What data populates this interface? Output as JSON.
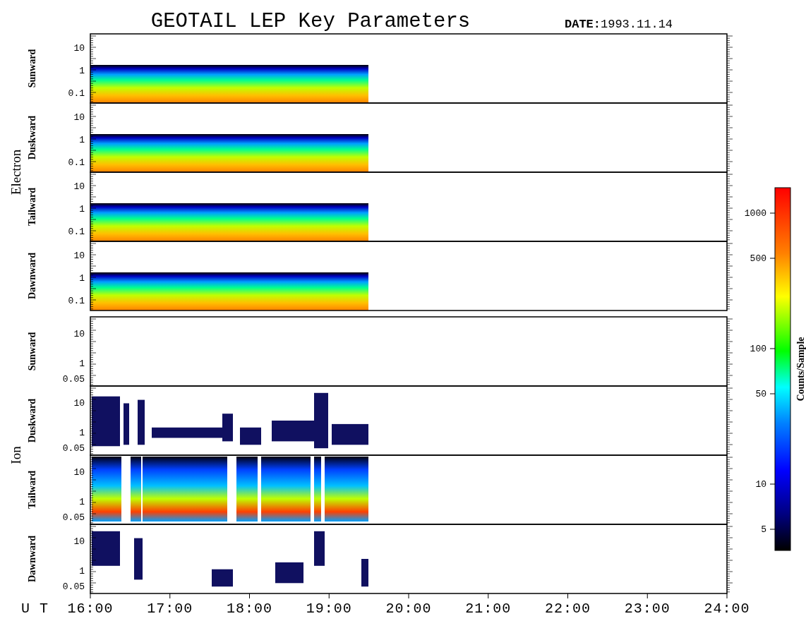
{
  "title": "GEOTAIL LEP Key Parameters",
  "date": {
    "label": "DATE:",
    "value": "1993.11.14"
  },
  "groups": [
    {
      "name": "Electron",
      "panels": [
        {
          "direction": "Sunward",
          "yticks": [
            "10",
            "1",
            "0.1"
          ]
        },
        {
          "direction": "Duskward",
          "yticks": [
            "10",
            "1",
            "0.1"
          ]
        },
        {
          "direction": "Tailward",
          "yticks": [
            "10",
            "1",
            "0.1"
          ]
        },
        {
          "direction": "Dawnward",
          "yticks": [
            "10",
            "1",
            "0.1"
          ]
        }
      ]
    },
    {
      "name": "Ion",
      "panels": [
        {
          "direction": "Sunward",
          "yticks": [
            "10",
            "1",
            "0.05"
          ]
        },
        {
          "direction": "Duskward",
          "yticks": [
            "10",
            "1",
            "0.05"
          ]
        },
        {
          "direction": "Tailward",
          "yticks": [
            "10",
            "1",
            "0.05"
          ]
        },
        {
          "direction": "Dawnward",
          "yticks": [
            "10",
            "1",
            "0.05"
          ]
        }
      ]
    }
  ],
  "x_axis": {
    "label": "U T",
    "ticks": [
      "16:00",
      "17:00",
      "18:00",
      "19:00",
      "20:00",
      "21:00",
      "22:00",
      "23:00",
      "24:00"
    ]
  },
  "colorbar": {
    "label": "Counts/Sample",
    "ticks": [
      "1000",
      "500",
      "100",
      "50",
      "10",
      "5"
    ]
  }
}
